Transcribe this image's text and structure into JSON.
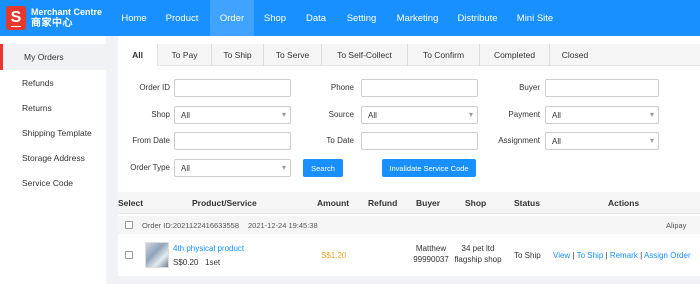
{
  "brand": {
    "logo_letter": "S",
    "name_en": "Merchant Centre",
    "name_zh": "商家中心"
  },
  "nav": {
    "items": [
      {
        "label": "Home"
      },
      {
        "label": "Product"
      },
      {
        "label": "Order"
      },
      {
        "label": "Shop"
      },
      {
        "label": "Data"
      },
      {
        "label": "Setting"
      },
      {
        "label": "Marketing"
      },
      {
        "label": "Distribute"
      },
      {
        "label": "Mini Site"
      }
    ],
    "active": "Order"
  },
  "sidebar": {
    "items": [
      {
        "label": "My Orders"
      },
      {
        "label": "Refunds"
      },
      {
        "label": "Returns"
      },
      {
        "label": "Shipping Template"
      },
      {
        "label": "Storage Address"
      },
      {
        "label": "Service Code"
      }
    ],
    "active": "My Orders"
  },
  "tabs": {
    "items": [
      {
        "label": "All"
      },
      {
        "label": "To Pay"
      },
      {
        "label": "To Ship"
      },
      {
        "label": "To Serve"
      },
      {
        "label": "To Self-Collect"
      },
      {
        "label": "To Confirm"
      },
      {
        "label": "Completed"
      },
      {
        "label": "Closed"
      }
    ],
    "active": "All"
  },
  "filters": {
    "order_id": {
      "label": "Order ID",
      "value": ""
    },
    "phone": {
      "label": "Phone",
      "value": ""
    },
    "buyer": {
      "label": "Buyer",
      "value": ""
    },
    "shop": {
      "label": "Shop",
      "value": "All"
    },
    "source": {
      "label": "Source",
      "value": "All"
    },
    "payment": {
      "label": "Payment",
      "value": "All"
    },
    "from_date": {
      "label": "From Date",
      "value": ""
    },
    "to_date": {
      "label": "To Date",
      "value": ""
    },
    "assignment": {
      "label": "Assignment",
      "value": "All"
    },
    "order_type": {
      "label": "Order Type",
      "value": "All"
    },
    "search_label": "Search",
    "invalidate_label": "Invalidate Service Code"
  },
  "table": {
    "headers": {
      "select": "Select",
      "product": "Product/Service",
      "amount": "Amount",
      "refund": "Refund",
      "buyer": "Buyer",
      "shop": "Shop",
      "status": "Status",
      "actions": "Actions"
    }
  },
  "order": {
    "id_text": "Order ID:2021122416633558",
    "datetime": "2021-12-24 19:45:38",
    "payment": "Alipay",
    "product_name": "4th physical product",
    "unit_price": "S$0.20",
    "quantity": "1set",
    "amount": "S$1.20",
    "buyer_name": "Matthew",
    "buyer_phone": "99990037",
    "shop_line1": "34 pet ltd",
    "shop_line2": "flagship shop",
    "status": "To Ship",
    "actions": {
      "view": "View",
      "to_ship": "To Ship",
      "remark": "Remark",
      "assign": "Assign Order",
      "sep": "|"
    }
  },
  "colors": {
    "primary": "#1890ff",
    "brand_red": "#e8372d",
    "price": "#f5a623"
  }
}
